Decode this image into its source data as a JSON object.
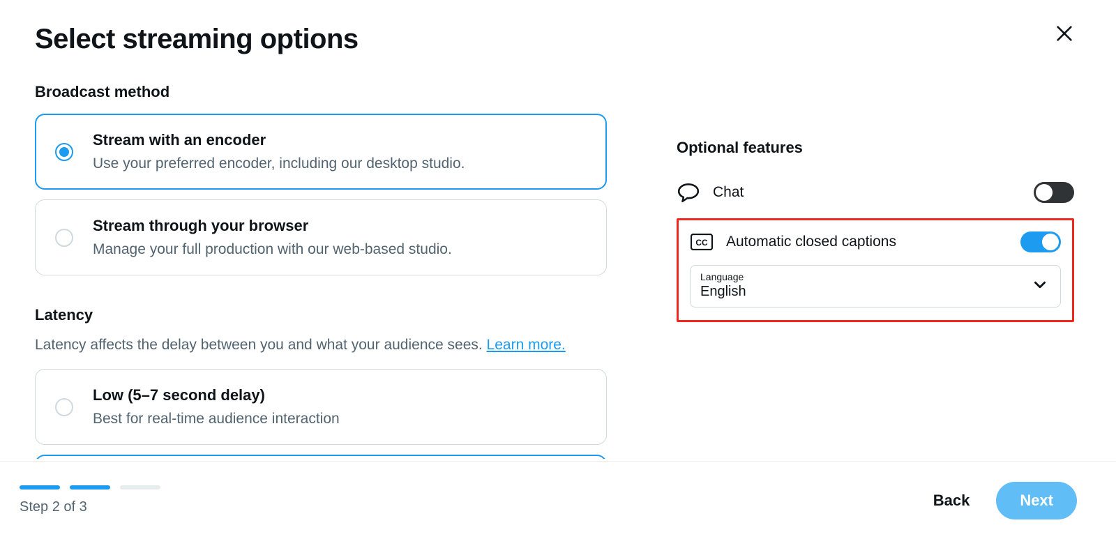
{
  "title": "Select streaming options",
  "broadcast": {
    "heading": "Broadcast method",
    "options": [
      {
        "title": "Stream with an encoder",
        "desc": "Use your preferred encoder, including our desktop studio.",
        "selected": true
      },
      {
        "title": "Stream through your browser",
        "desc": "Manage your full production with our web-based studio.",
        "selected": false
      }
    ]
  },
  "latency": {
    "heading": "Latency",
    "intro_prefix": "Latency affects the delay between you and what your audience sees. ",
    "learn_more": "Learn more.",
    "options": [
      {
        "title": "Low (5–7 second delay)",
        "desc": "Best for real-time audience interaction",
        "selected": false
      }
    ]
  },
  "optional": {
    "heading": "Optional features",
    "chat_label": "Chat",
    "chat_on": false,
    "captions_label": "Automatic closed captions",
    "captions_on": true,
    "language_label": "Language",
    "language_value": "English"
  },
  "footer": {
    "step_text": "Step 2 of 3",
    "back": "Back",
    "next": "Next",
    "current_step": 2,
    "total_steps": 3
  }
}
